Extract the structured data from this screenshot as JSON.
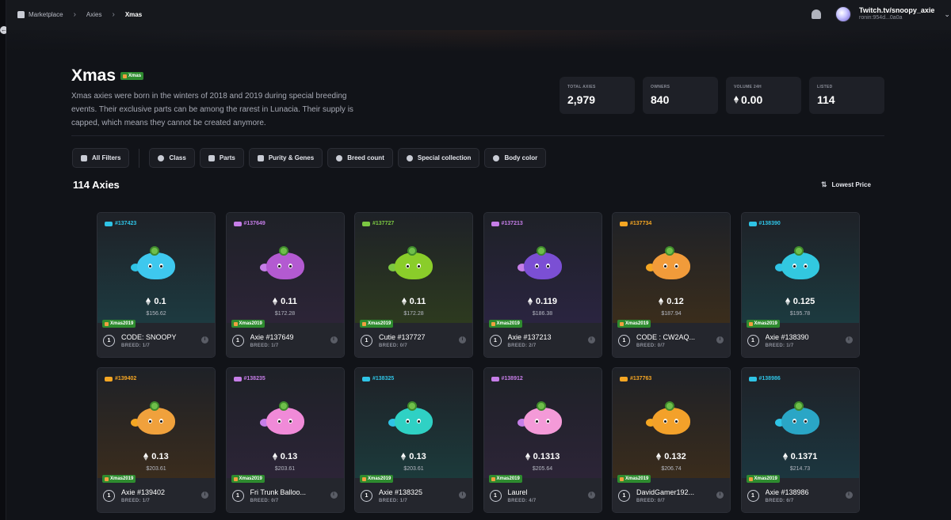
{
  "breadcrumb": {
    "home": "Marketplace",
    "middle": "Axies",
    "current": "Xmas"
  },
  "account": {
    "name": "Twitch.tv/snoopy_axie",
    "address": "ronin:954d...0a0a"
  },
  "hero": {
    "title": "Xmas",
    "badge": "Xmas",
    "description": "Xmas axies were born in the winters of 2018 and 2019 during special breeding events. Their exclusive parts can be among the rarest in Lunacia. Their supply is capped, which means they cannot be created anymore."
  },
  "stats": [
    {
      "label": "TOTAL AXIES",
      "value": "2,979"
    },
    {
      "label": "OWNERS",
      "value": "840"
    },
    {
      "label": "VOLUME 24H",
      "value": "0.00"
    },
    {
      "label": "LISTED",
      "value": "114"
    }
  ],
  "filters": {
    "all": "All Filters",
    "items": [
      "Class",
      "Parts",
      "Purity & Genes",
      "Breed count",
      "Special collection",
      "Body color"
    ]
  },
  "results": {
    "count": "114 Axies",
    "sort": "Lowest Price"
  },
  "colors": {
    "aquatic": "#2fc4e6",
    "bird": "#ff8ab8",
    "plant": "#7cc842",
    "beast": "#f5a623",
    "bug": "#ff5346",
    "reptile": "#c67ee8",
    "xmas_badge": "#2e8b2f"
  },
  "cards": [
    {
      "id": "#137423",
      "class": "aquatic",
      "price": "0.1",
      "usd": "$156.62",
      "badge": "Xmas2019",
      "name": "CODE: SNOOPY",
      "breed": "BREED: 1/7",
      "num": "1",
      "body": "#3ec8ee",
      "bg": "#1d3a40"
    },
    {
      "id": "#137649",
      "class": "reptile",
      "price": "0.11",
      "usd": "$172.28",
      "badge": "Xmas2019",
      "name": "Axie #137649",
      "breed": "BREED: 1/7",
      "num": "1",
      "body": "#b35ad1",
      "bg": "#2c2437"
    },
    {
      "id": "#137727",
      "class": "plant",
      "price": "0.11",
      "usd": "$172.28",
      "badge": "Xmas2019",
      "name": "Cutie #137727",
      "breed": "BREED: 0/7",
      "num": "1",
      "body": "#8acd2a",
      "bg": "#2d3a1f"
    },
    {
      "id": "#137213",
      "class": "reptile",
      "price": "0.119",
      "usd": "$186.38",
      "badge": "Xmas2019",
      "name": "Axie #137213",
      "breed": "BREED: 2/7",
      "num": "1",
      "body": "#7b4fd4",
      "bg": "#2a2440"
    },
    {
      "id": "#137734",
      "class": "beast",
      "price": "0.12",
      "usd": "$187.94",
      "badge": "Xmas2019",
      "name": "CODE : CW2AQ...",
      "breed": "BREED: 0/7",
      "num": "1",
      "body": "#f19b3a",
      "bg": "#3a2d1c"
    },
    {
      "id": "#138390",
      "class": "aquatic",
      "price": "0.125",
      "usd": "$195.78",
      "badge": "Xmas2019",
      "name": "Axie #138390",
      "breed": "BREED: 1/7",
      "num": "1",
      "body": "#32c8e0",
      "bg": "#1c3a3f"
    },
    {
      "id": "#139402",
      "class": "beast",
      "price": "0.13",
      "usd": "$203.61",
      "badge": "Xmas2019",
      "name": "Axie #139402",
      "breed": "BREED: 1/7",
      "num": "1",
      "body": "#f0a13c",
      "bg": "#3a2c1d"
    },
    {
      "id": "#138235",
      "class": "reptile",
      "price": "0.13",
      "usd": "$203.61",
      "badge": "Xmas2019",
      "name": "Fri Trunk Balloo...",
      "breed": "BREED: 0/7",
      "num": "1",
      "body": "#f08ad8",
      "bg": "#2c2437"
    },
    {
      "id": "#138325",
      "class": "aquatic",
      "price": "0.13",
      "usd": "$203.61",
      "badge": "Xmas2019",
      "name": "Axie #138325",
      "breed": "BREED: 1/7",
      "num": "1",
      "body": "#2fd1c4",
      "bg": "#1c3a3b"
    },
    {
      "id": "#138912",
      "class": "reptile",
      "price": "0.1313",
      "usd": "$205.64",
      "badge": "Xmas2019",
      "name": "Laurel",
      "breed": "BREED: 4/7",
      "num": "1",
      "body": "#f49ad8",
      "bg": "#2c2437"
    },
    {
      "id": "#137763",
      "class": "beast",
      "price": "0.132",
      "usd": "$206.74",
      "badge": "Xmas2019",
      "name": "DavidGamer192...",
      "breed": "BREED: 0/7",
      "num": "1",
      "body": "#f3a12a",
      "bg": "#3a2c1c"
    },
    {
      "id": "#138986",
      "class": "aquatic",
      "price": "0.1371",
      "usd": "$214.73",
      "badge": "Xmas2019",
      "name": "Axie #138986",
      "breed": "BREED: 6/7",
      "num": "1",
      "body": "#2aa6c6",
      "bg": "#1c363f"
    }
  ]
}
